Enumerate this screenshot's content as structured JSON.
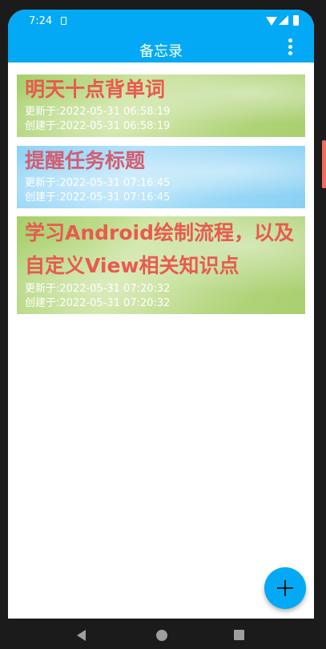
{
  "status_bar": {
    "time": "7:24",
    "icons": [
      "sim-card-icon",
      "wifi-icon",
      "cell-signal-icon",
      "battery-icon"
    ]
  },
  "app_bar": {
    "title": "备忘录",
    "menu_icon": "more-vert-icon"
  },
  "notes": [
    {
      "title": "明天十点背单词",
      "updated": "更新于:2022-05-31 06:58:19",
      "created": "创建于:2022-05-31 06:58:19",
      "theme": "green"
    },
    {
      "title": "提醒任务标题",
      "updated": "更新于:2022-05-31 07:16:45",
      "created": "创建于:2022-05-31 07:16:45",
      "theme": "blue"
    },
    {
      "title": "学习Android绘制流程，以及自定义View相关知识点",
      "updated": "更新于:2022-05-31 07:20:32",
      "created": "创建于:2022-05-31 07:20:32",
      "theme": "green"
    }
  ],
  "fab": {
    "icon": "plus-icon"
  },
  "nav_bar": {
    "icons": [
      "back-icon",
      "home-icon",
      "recents-icon"
    ]
  },
  "colors": {
    "primary": "#03a9f4",
    "note_title_green": "#e85a4f",
    "note_title_blue": "#d25e73"
  }
}
